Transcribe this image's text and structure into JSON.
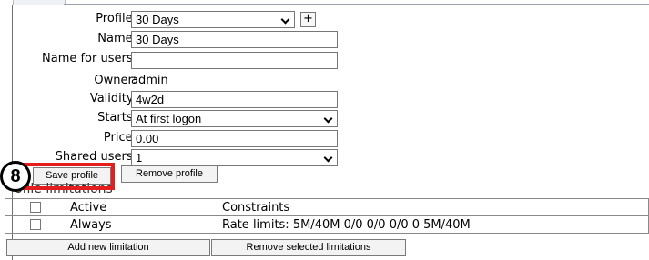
{
  "form": {
    "profile_label": "Profile:",
    "profile_value": "30 Days",
    "add_button_label": "+",
    "name_label": "Name:",
    "name_value": "30 Days",
    "name_for_users_label": "Name for users:",
    "name_for_users_value": "",
    "owner_label": "Owner:",
    "owner_value": "admin",
    "validity_label": "Validity:",
    "validity_value": "4w2d",
    "starts_label": "Starts:",
    "starts_value": "At first logon",
    "price_label": "Price:",
    "price_value": "0.00",
    "shared_users_label": "Shared users:",
    "shared_users_value": "1"
  },
  "actions": {
    "save_label": "Save profile",
    "remove_label": "Remove profile"
  },
  "limitations": {
    "section_title": "ofile limitations",
    "header": {
      "active": "Active",
      "constraints": "Constraints"
    },
    "rows": [
      {
        "name": "Always",
        "constraints": "Rate limits: 5M/40M 0/0 0/0 0/0 0 5M/40M"
      }
    ],
    "add_label": "Add new limitation",
    "remove_selected_label": "Remove selected limitations"
  },
  "annotation": {
    "step_number": "8",
    "highlight_color": "#e51d1d"
  }
}
